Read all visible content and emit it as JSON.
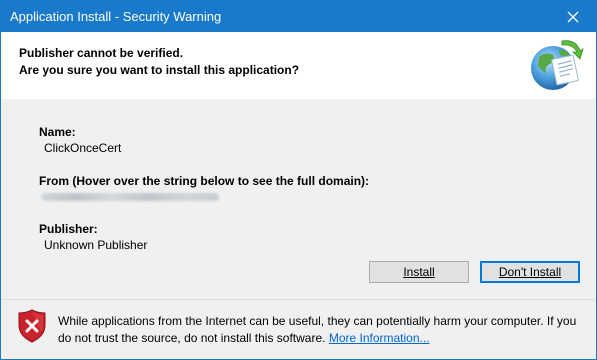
{
  "window": {
    "title": "Application Install - Security Warning",
    "close_symbol": "×"
  },
  "header": {
    "line1": "Publisher cannot be verified.",
    "line2": "Are you sure you want to install this application?",
    "icon": "globe-install-icon"
  },
  "details": {
    "name_label": "Name:",
    "name_value": "ClickOnceCert",
    "from_label": "From (Hover over the string below to see the full domain):",
    "publisher_label": "Publisher:",
    "publisher_value": "Unknown Publisher"
  },
  "buttons": {
    "install_label": "Install",
    "dont_install_label": "Don't Install"
  },
  "footer": {
    "warning_text": "While applications from the Internet can be useful, they can potentially harm your computer. If you do not trust the source, do not install this software.",
    "more_info_label": "More Information...",
    "icon": "shield-error-icon"
  },
  "colors": {
    "titlebar": "#1979ca",
    "link": "#0066cc",
    "shield": "#c8232c",
    "default_button_border": "#0078d7"
  }
}
